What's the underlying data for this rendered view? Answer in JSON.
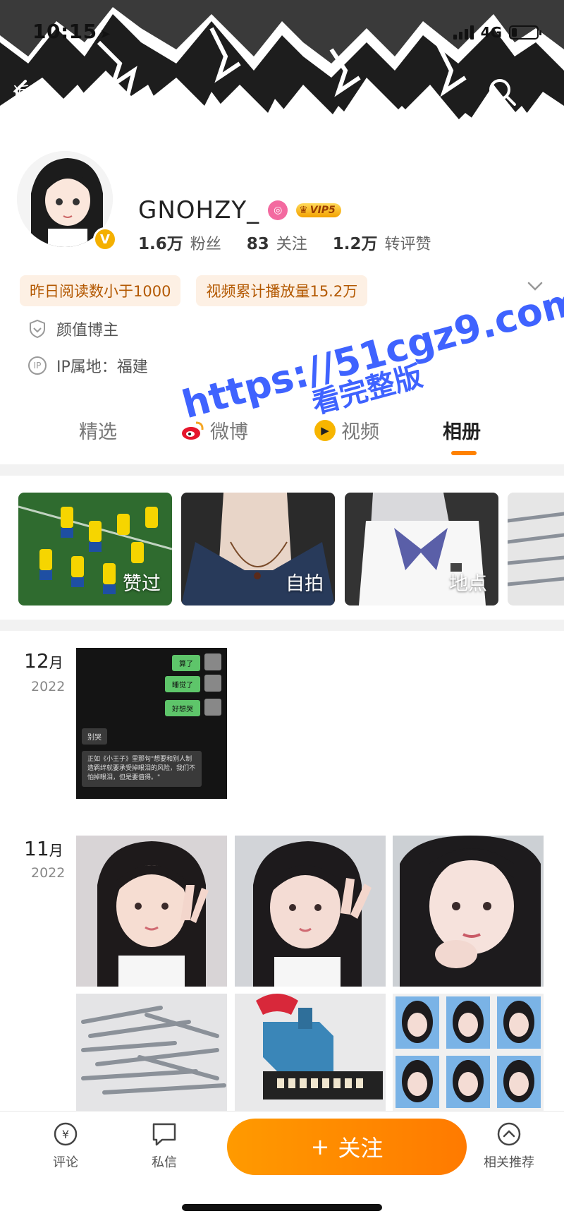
{
  "status_bar": {
    "time": "10:15",
    "network": "4G",
    "battery_level": 0.2
  },
  "header": {
    "back_label": "返回"
  },
  "profile": {
    "username": "GNOHZY_",
    "vip_label": "VIP5",
    "stats": [
      {
        "value": "1.6万",
        "label": "粉丝"
      },
      {
        "value": "83",
        "label": "关注"
      },
      {
        "value": "1.2万",
        "label": "转评赞"
      }
    ],
    "tags": [
      "昨日阅读数小于1000",
      "视频累计播放量15.2万"
    ],
    "identity": "颜值博主",
    "ip_location": "IP属地：福建"
  },
  "watermark": {
    "line1": "https://51cgz9.com",
    "line2": "看完整版"
  },
  "tabs": [
    {
      "label": "精选"
    },
    {
      "label": "微博"
    },
    {
      "label": "视频"
    },
    {
      "label": "相册"
    }
  ],
  "active_tab": "相册",
  "albums": [
    {
      "label": "赞过"
    },
    {
      "label": "自拍"
    },
    {
      "label": "地点"
    }
  ],
  "chat_preview": {
    "bubbles": [
      "算了",
      "睡觉了",
      "好想哭"
    ],
    "left_msg": "别哭",
    "quote": "正如《小王子》里那句\"想要和别人制造羁绊就要承受掉眼泪的风险，我们不怕掉眼泪，但是要值得。\""
  },
  "timeline": [
    {
      "month": "12",
      "unit": "月",
      "year": "2022"
    },
    {
      "month": "11",
      "unit": "月",
      "year": "2022"
    }
  ],
  "bottom_bar": {
    "left1": "评论",
    "left2": "私信",
    "follow": "关注",
    "right": "相关推荐"
  },
  "colors": {
    "accent": "#ff8200",
    "watermark": "#3f63ff",
    "tag_bg": "#fdf0e4"
  }
}
